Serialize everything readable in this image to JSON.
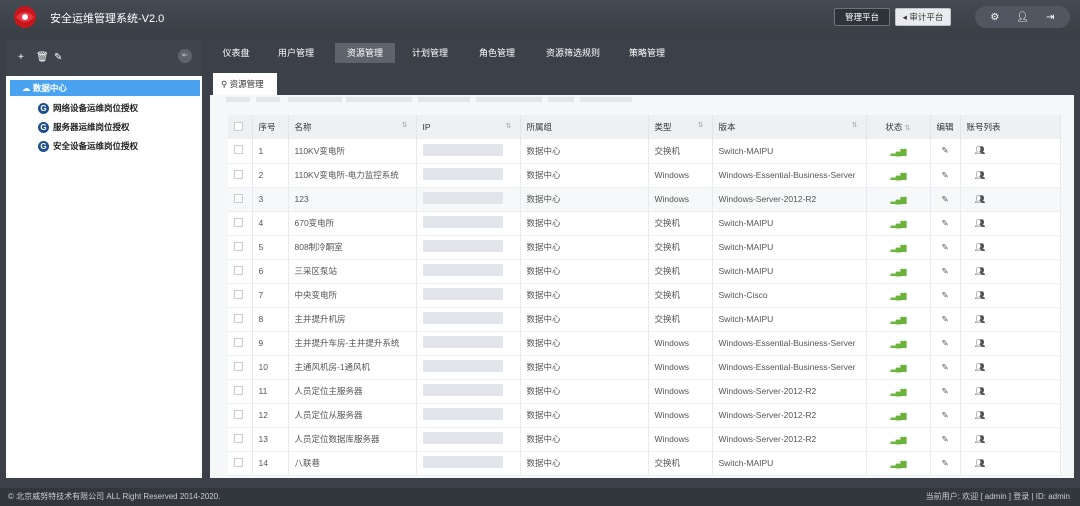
{
  "app": {
    "title": "安全运维管理系统-V2.0"
  },
  "header": {
    "btn_manage": "管理平台",
    "btn_audit": "审计平台",
    "icons": [
      "gear-icon",
      "user-icon",
      "logout-icon"
    ]
  },
  "sidebar": {
    "toolbar_icons": [
      "plus-icon",
      "trash-icon",
      "pencil-icon"
    ],
    "root": "数据中心",
    "items": [
      {
        "label": "网络设备运维岗位授权"
      },
      {
        "label": "服务器运维岗位授权"
      },
      {
        "label": "安全设备运维岗位授权"
      }
    ]
  },
  "nav": {
    "tabs": [
      {
        "label": "仪表盘",
        "active": false
      },
      {
        "label": "用户管理",
        "active": false
      },
      {
        "label": "资源管理",
        "active": true
      },
      {
        "label": "计划管理",
        "active": false
      },
      {
        "label": "角色管理",
        "active": false
      },
      {
        "label": "资源筛选规则",
        "active": false
      },
      {
        "label": "策略管理",
        "active": false
      }
    ],
    "sub_tab": "资源管理"
  },
  "table": {
    "headers": [
      "序号",
      "名称",
      "IP",
      "所属组",
      "类型",
      "版本",
      "状态",
      "编辑",
      "账号列表"
    ],
    "rows": [
      {
        "no": "1",
        "name": "110KV变电所",
        "group": "数据中心",
        "type": "交换机",
        "version": "Switch-MAIPU"
      },
      {
        "no": "2",
        "name": "110KV变电所-电力监控系统",
        "group": "数据中心",
        "type": "Windows",
        "version": "Windows-Essential-Business-Server"
      },
      {
        "no": "3",
        "name": "123",
        "group": "数据中心",
        "type": "Windows",
        "version": "Windows-Server-2012-R2"
      },
      {
        "no": "4",
        "name": "670变电所",
        "group": "数据中心",
        "type": "交换机",
        "version": "Switch-MAIPU"
      },
      {
        "no": "5",
        "name": "808制冷酮室",
        "group": "数据中心",
        "type": "交换机",
        "version": "Switch-MAIPU"
      },
      {
        "no": "6",
        "name": "三采区泵站",
        "group": "数据中心",
        "type": "交换机",
        "version": "Switch-MAIPU"
      },
      {
        "no": "7",
        "name": "中央变电所",
        "group": "数据中心",
        "type": "交换机",
        "version": "Switch-Cisco"
      },
      {
        "no": "8",
        "name": "主井提升机房",
        "group": "数据中心",
        "type": "交换机",
        "version": "Switch-MAIPU"
      },
      {
        "no": "9",
        "name": "主井提升车房-主井提升系统",
        "group": "数据中心",
        "type": "Windows",
        "version": "Windows-Essential-Business-Server"
      },
      {
        "no": "10",
        "name": "主通风机房-1通风机",
        "group": "数据中心",
        "type": "Windows",
        "version": "Windows-Essential-Business-Server"
      },
      {
        "no": "11",
        "name": "人员定位主服务器",
        "group": "数据中心",
        "type": "Windows",
        "version": "Windows-Server-2012-R2"
      },
      {
        "no": "12",
        "name": "人员定位从服务器",
        "group": "数据中心",
        "type": "Windows",
        "version": "Windows-Server-2012-R2"
      },
      {
        "no": "13",
        "name": "人员定位数据库服务器",
        "group": "数据中心",
        "type": "Windows",
        "version": "Windows-Server-2012-R2"
      },
      {
        "no": "14",
        "name": "八联巷",
        "group": "数据中心",
        "type": "交换机",
        "version": "Switch-MAIPU"
      }
    ]
  },
  "footer": {
    "copyright": "© 北京威努特技术有限公司 ALL Right Reserved 2014-2020.",
    "user_info": "当前用户: 欢迎 [ admin ] 登录 | ID: admin"
  }
}
